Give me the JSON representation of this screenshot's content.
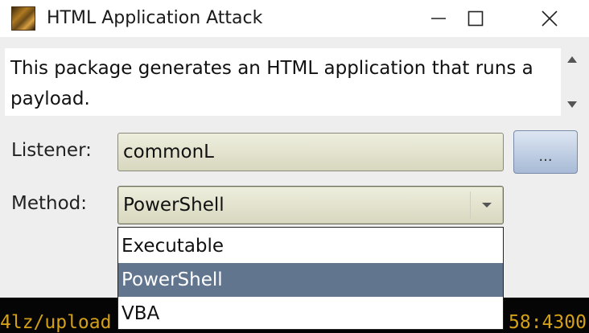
{
  "window": {
    "title": "HTML Application Attack",
    "icon": "app-icon",
    "controls": [
      "minimize-icon",
      "maximize-icon",
      "close-icon"
    ]
  },
  "description": "This package generates an HTML application that runs a payload.",
  "form": {
    "listener_label": "Listener:",
    "listener_value": "commonL",
    "browse_label": "...",
    "method_label": "Method:",
    "method_value": "PowerShell"
  },
  "dropdown": {
    "options": [
      "Executable",
      "PowerShell",
      "VBA"
    ],
    "selected": "PowerShell"
  },
  "background_terminal": {
    "left_text": "4lz/upload",
    "right_text": "58:4300"
  },
  "colors": {
    "selection": "#62758f",
    "terminal_text": "#d4a017",
    "field_bg": "#e4e4d0"
  }
}
